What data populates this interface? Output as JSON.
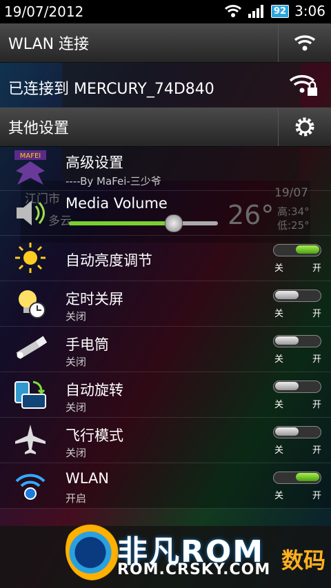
{
  "status": {
    "date": "19/07/2012",
    "battery": "92",
    "time": "3:06"
  },
  "wlan_header": {
    "label": "WLAN 连接",
    "icon": "wifi-icon"
  },
  "connected": {
    "label": "已连接到 MERCURY_74D840",
    "icon": "wifi-lock-icon"
  },
  "other_header": {
    "label": "其他设置",
    "icon": "gear-icon"
  },
  "background": {
    "city": "江门市",
    "condition": "多云",
    "temp": "26°",
    "date": "19/07",
    "high": "高:34°",
    "low": "低:25°"
  },
  "advanced": {
    "title": "高级设置",
    "subtitle": "----By MaFei-三少爷",
    "badge": "MAFEI"
  },
  "media": {
    "title": "Media Volume",
    "level": 0.7
  },
  "toggle_labels": {
    "off": "关",
    "on": "开"
  },
  "rows": [
    {
      "title": "自动亮度调节",
      "subtitle": "",
      "icon": "sun-icon",
      "state": "on"
    },
    {
      "title": "定时关屏",
      "subtitle": "关闭",
      "icon": "bulb-timer-icon",
      "state": "off"
    },
    {
      "title": "手电筒",
      "subtitle": "关闭",
      "icon": "flashlight-icon",
      "state": "off"
    },
    {
      "title": "自动旋转",
      "subtitle": "关闭",
      "icon": "rotate-icon",
      "state": "off"
    },
    {
      "title": "飞行模式",
      "subtitle": "关闭",
      "icon": "airplane-icon",
      "state": "off"
    },
    {
      "title": "WLAN",
      "subtitle": "开启",
      "icon": "wifi-icon",
      "state": "on"
    }
  ],
  "watermark": {
    "brand": "非凡ROM",
    "url": "ROM.CRSKY.COM",
    "side": "数码"
  }
}
